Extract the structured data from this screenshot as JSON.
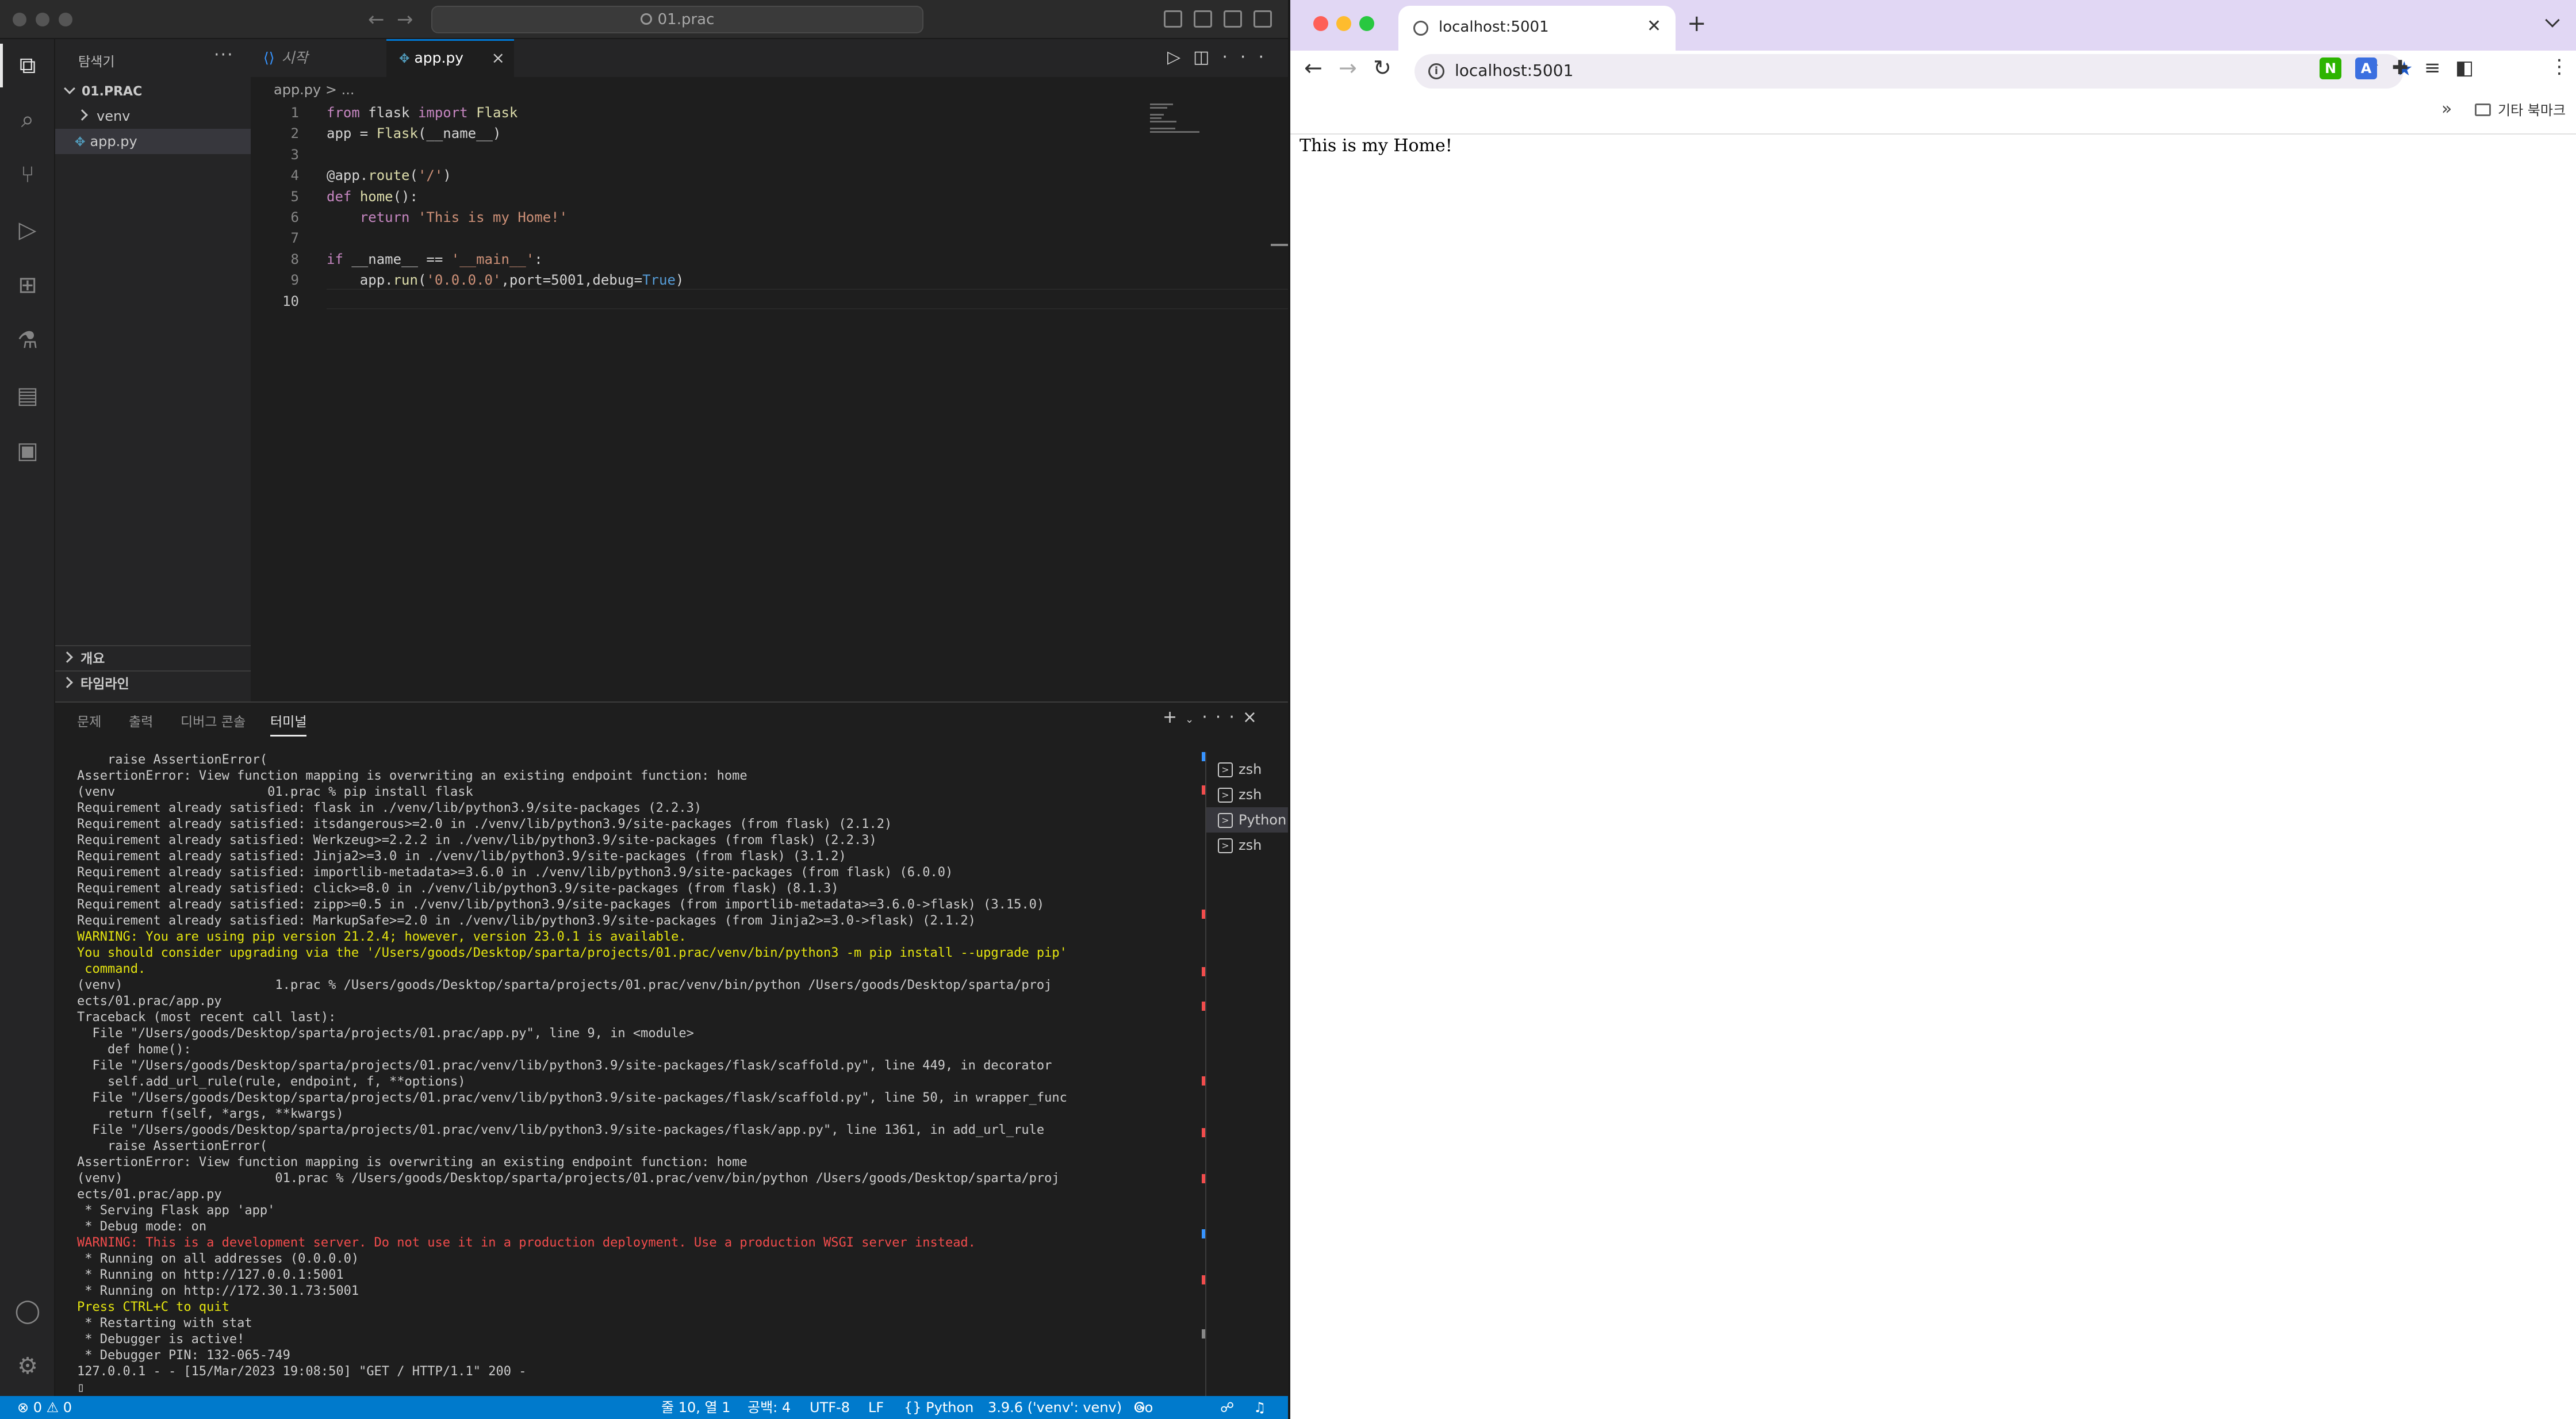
{
  "vscode": {
    "titlebar": {
      "search_text": "01.prac"
    },
    "activitybar": {
      "icons": [
        "explorer-icon",
        "search-icon",
        "source-control-icon",
        "run-debug-icon",
        "extensions-icon",
        "testing-icon",
        "notebook-icon",
        "remote-explorer-icon",
        "account-icon",
        "settings-gear-icon"
      ]
    },
    "sidebar": {
      "title": "탐색기",
      "folder": "01.PRAC",
      "items": [
        {
          "label": "venv",
          "type": "folder"
        },
        {
          "label": "app.py",
          "type": "file"
        }
      ],
      "outline_label": "개요",
      "timeline_label": "타임라인"
    },
    "tabs": [
      {
        "label": "시작",
        "active": false
      },
      {
        "label": "app.py",
        "active": true,
        "close": "×"
      }
    ],
    "breadcrumb": "app.py  >  ...",
    "code_lines": [
      {
        "n": "1",
        "text": "from flask import Flask"
      },
      {
        "n": "2",
        "text": "app = Flask(__name__)"
      },
      {
        "n": "3",
        "text": ""
      },
      {
        "n": "4",
        "text": "@app.route('/')"
      },
      {
        "n": "5",
        "text": "def home():"
      },
      {
        "n": "6",
        "text": "    return 'This is my Home!'"
      },
      {
        "n": "7",
        "text": ""
      },
      {
        "n": "8",
        "text": "if __name__ == '__main__':"
      },
      {
        "n": "9",
        "text": "    app.run('0.0.0.0',port=5001,debug=True)"
      },
      {
        "n": "10",
        "text": ""
      }
    ],
    "panel": {
      "tabs": [
        "문제",
        "출력",
        "디버그 콘솔",
        "터미널"
      ],
      "active_tab": "터미널",
      "terminal_lines": [
        {
          "text": "    raise AssertionError(",
          "cls": ""
        },
        {
          "text": "AssertionError: View function mapping is overwriting an existing endpoint function: home",
          "cls": ""
        },
        {
          "text": "(venv                    01.prac % pip install flask",
          "cls": "",
          "mark": "ok"
        },
        {
          "text": "Requirement already satisfied: flask in ./venv/lib/python3.9/site-packages (2.2.3)",
          "cls": ""
        },
        {
          "text": "Requirement already satisfied: itsdangerous>=2.0 in ./venv/lib/python3.9/site-packages (from flask) (2.1.2)",
          "cls": ""
        },
        {
          "text": "Requirement already satisfied: Werkzeug>=2.2.2 in ./venv/lib/python3.9/site-packages (from flask) (2.2.3)",
          "cls": ""
        },
        {
          "text": "Requirement already satisfied: Jinja2>=3.0 in ./venv/lib/python3.9/site-packages (from flask) (3.1.2)",
          "cls": ""
        },
        {
          "text": "Requirement already satisfied: importlib-metadata>=3.6.0 in ./venv/lib/python3.9/site-packages (from flask) (6.0.0)",
          "cls": ""
        },
        {
          "text": "Requirement already satisfied: click>=8.0 in ./venv/lib/python3.9/site-packages (from flask) (8.1.3)",
          "cls": ""
        },
        {
          "text": "Requirement already satisfied: zipp>=0.5 in ./venv/lib/python3.9/site-packages (from importlib-metadata>=3.6.0->flask) (3.15.0)",
          "cls": ""
        },
        {
          "text": "Requirement already satisfied: MarkupSafe>=2.0 in ./venv/lib/python3.9/site-packages (from Jinja2>=3.0->flask) (2.1.2)",
          "cls": ""
        },
        {
          "text": "WARNING: You are using pip version 21.2.4; however, version 23.0.1 is available.",
          "cls": "t-warn"
        },
        {
          "text": "You should consider upgrading via the '/Users/goods/Desktop/sparta/projects/01.prac/venv/bin/python3 -m pip install --upgrade pip'",
          "cls": "t-warn"
        },
        {
          "text": " command.",
          "cls": "t-warn"
        },
        {
          "text": "(venv)                    1.prac % /Users/goods/Desktop/sparta/projects/01.prac/venv/bin/python /Users/goods/Desktop/sparta/proj",
          "cls": "",
          "mark": "err"
        },
        {
          "text": "ects/01.prac/app.py",
          "cls": ""
        },
        {
          "text": "Traceback (most recent call last):",
          "cls": ""
        },
        {
          "text": "  File \"/Users/goods/Desktop/sparta/projects/01.prac/app.py\", line 9, in <module>",
          "cls": ""
        },
        {
          "text": "    def home():",
          "cls": ""
        },
        {
          "text": "  File \"/Users/goods/Desktop/sparta/projects/01.prac/venv/lib/python3.9/site-packages/flask/scaffold.py\", line 449, in decorator",
          "cls": ""
        },
        {
          "text": "    self.add_url_rule(rule, endpoint, f, **options)",
          "cls": ""
        },
        {
          "text": "  File \"/Users/goods/Desktop/sparta/projects/01.prac/venv/lib/python3.9/site-packages/flask/scaffold.py\", line 50, in wrapper_func",
          "cls": ""
        },
        {
          "text": "    return f(self, *args, **kwargs)",
          "cls": ""
        },
        {
          "text": "  File \"/Users/goods/Desktop/sparta/projects/01.prac/venv/lib/python3.9/site-packages/flask/app.py\", line 1361, in add_url_rule",
          "cls": ""
        },
        {
          "text": "    raise AssertionError(",
          "cls": ""
        },
        {
          "text": "AssertionError: View function mapping is overwriting an existing endpoint function: home",
          "cls": ""
        },
        {
          "text": "(venv)                    01.prac % /Users/goods/Desktop/sparta/projects/01.prac/venv/bin/python /Users/goods/Desktop/sparta/proj",
          "cls": "",
          "mark": "none"
        },
        {
          "text": "ects/01.prac/app.py",
          "cls": ""
        },
        {
          "text": " * Serving Flask app 'app'",
          "cls": ""
        },
        {
          "text": " * Debug mode: on",
          "cls": ""
        },
        {
          "text": "WARNING: This is a development server. Do not use it in a production deployment. Use a production WSGI server instead.",
          "cls": "t-err"
        },
        {
          "text": " * Running on all addresses (0.0.0.0)",
          "cls": ""
        },
        {
          "text": " * Running on http://127.0.0.1:5001",
          "cls": ""
        },
        {
          "text": " * Running on http://172.30.1.73:5001",
          "cls": ""
        },
        {
          "text": "Press CTRL+C to quit",
          "cls": "t-warn"
        },
        {
          "text": " * Restarting with stat",
          "cls": ""
        },
        {
          "text": " * Debugger is active!",
          "cls": ""
        },
        {
          "text": " * Debugger PIN: 132-065-749",
          "cls": ""
        },
        {
          "text": "127.0.0.1 - - [15/Mar/2023 19:08:50] \"GET / HTTP/1.1\" 200 -",
          "cls": ""
        },
        {
          "text": "▯",
          "cls": ""
        }
      ],
      "terminals": [
        {
          "label": "zsh",
          "selected": false
        },
        {
          "label": "zsh",
          "selected": false
        },
        {
          "label": "Python",
          "selected": true
        },
        {
          "label": "zsh",
          "selected": false
        }
      ]
    },
    "statusbar": {
      "problems": "⊗ 0 ⚠ 0",
      "position": "줄 10, 열 1",
      "spaces": "공백: 4",
      "encoding": "UTF-8",
      "eol": "LF",
      "language": "{} Python",
      "interpreter": "3.9.6 ('venv': venv)",
      "golive": "Go Live"
    }
  },
  "chrome": {
    "tab_title": "localhost:5001",
    "url": "localhost:5001",
    "bookmarks_more": "»",
    "bookmarks_folder": "기타 북마크",
    "page_text": "This is my Home!",
    "colors": {
      "tabstrip": "#e1d7f4",
      "star": "#1a57c8"
    }
  }
}
